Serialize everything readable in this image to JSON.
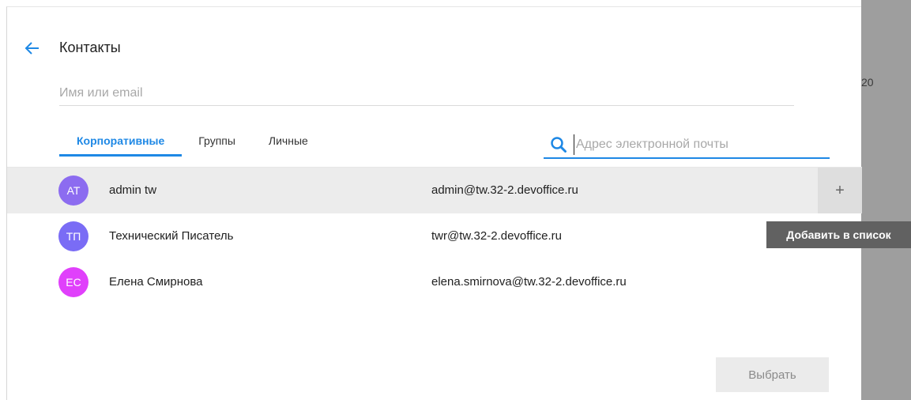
{
  "background": {
    "text": "20"
  },
  "dialog": {
    "title": "Контакты",
    "name_search": {
      "placeholder": "Имя или email",
      "value": ""
    },
    "tabs": [
      {
        "label": "Корпоративные",
        "active": true
      },
      {
        "label": "Группы",
        "active": false
      },
      {
        "label": "Личные",
        "active": false
      }
    ],
    "email_search": {
      "placeholder": "Адрес электронной почты",
      "value": ""
    },
    "contacts": [
      {
        "initials": "AT",
        "name": "admin tw",
        "email": "admin@tw.32-2.devoffice.ru",
        "avatar_color": "#8c6cf0",
        "hovered": true
      },
      {
        "initials": "ТП",
        "name": "Технический Писатель",
        "email": "twr@tw.32-2.devoffice.ru",
        "avatar_color": "#7a6cf5",
        "hovered": false
      },
      {
        "initials": "ЕС",
        "name": "Елена Смирнова",
        "email": "elena.smirnova@tw.32-2.devoffice.ru",
        "avatar_color": "#e040fb",
        "hovered": false
      }
    ],
    "add_button": {
      "icon": "plus-icon",
      "label": "+"
    },
    "tooltip": "Добавить в список",
    "select_button": "Выбрать",
    "accent_color": "#1e88e5"
  }
}
